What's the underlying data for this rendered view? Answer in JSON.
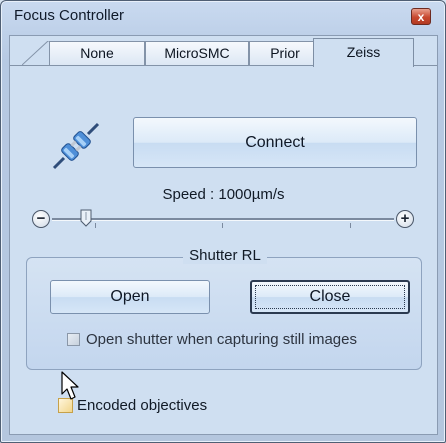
{
  "window": {
    "title": "Focus Controller",
    "close_glyph": "x"
  },
  "tabs": [
    {
      "label": "None",
      "selected": false
    },
    {
      "label": "MicroSMC",
      "selected": false
    },
    {
      "label": "Prior",
      "selected": false
    },
    {
      "label": "Zeiss",
      "selected": true
    }
  ],
  "connect": {
    "icon": "plug-connector-icon",
    "label": "Connect"
  },
  "speed": {
    "label": "Speed : 1000µm/s",
    "minus_glyph": "−",
    "plus_glyph": "+",
    "slider_value_fraction": 0.1
  },
  "shutter": {
    "legend": "Shutter RL",
    "open_label": "Open",
    "close_label": "Close",
    "capture_option_label": "Open shutter when capturing still images",
    "capture_option_checked": false,
    "capture_option_enabled": false
  },
  "encoded_objectives": {
    "label": "Encoded objectives",
    "checked": false
  },
  "colors": {
    "accent": "#cfdff1",
    "window_frame": "#4f5f74",
    "close_button": "#c8482f"
  }
}
